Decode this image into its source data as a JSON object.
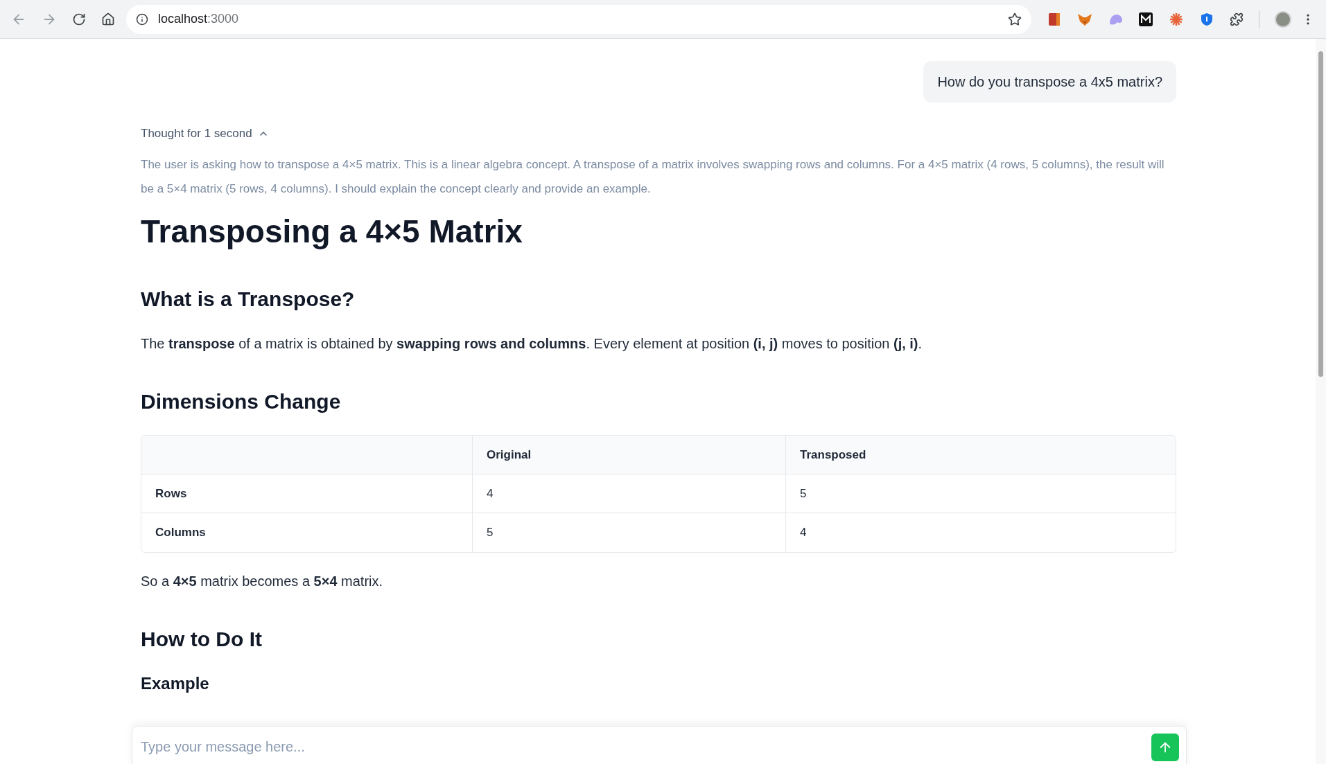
{
  "browser": {
    "url_host": "localhost",
    "url_port": ":3000"
  },
  "user_message": "How do you transpose a 4x5 matrix?",
  "thought": {
    "label": "Thought for 1 second",
    "expanded": true,
    "text": "The user is asking how to transpose a 4×5 matrix. This is a linear algebra concept. A transpose of a matrix involves swapping rows and columns. For a 4×5 matrix (4 rows, 5 columns), the result will be a 5×4 matrix (5 rows, 4 columns). I should explain the concept clearly and provide an example."
  },
  "answer": [
    {
      "kind": "h1",
      "text": "Transposing a 4×5 Matrix"
    },
    {
      "kind": "h2",
      "text": "What is a Transpose?"
    },
    {
      "kind": "p",
      "text": "The **transpose** of a matrix is obtained by **swapping rows and columns**. Every element at position **(i, j)** moves to position **(j, i)**."
    },
    {
      "kind": "h2",
      "text": "Dimensions Change"
    },
    {
      "kind": "table",
      "columns": [
        "Original",
        "Transposed"
      ],
      "rows": [
        {
          "label": "Rows",
          "cells": [
            "4",
            "5"
          ]
        },
        {
          "label": "Columns",
          "cells": [
            "5",
            "4"
          ]
        }
      ]
    },
    {
      "kind": "p",
      "text": "So a **4×5** matrix becomes a **5×4** matrix."
    },
    {
      "kind": "h2",
      "text": "How to Do It"
    },
    {
      "kind": "h3",
      "text": "Example"
    }
  ],
  "composer": {
    "placeholder": "Type your message here..."
  }
}
